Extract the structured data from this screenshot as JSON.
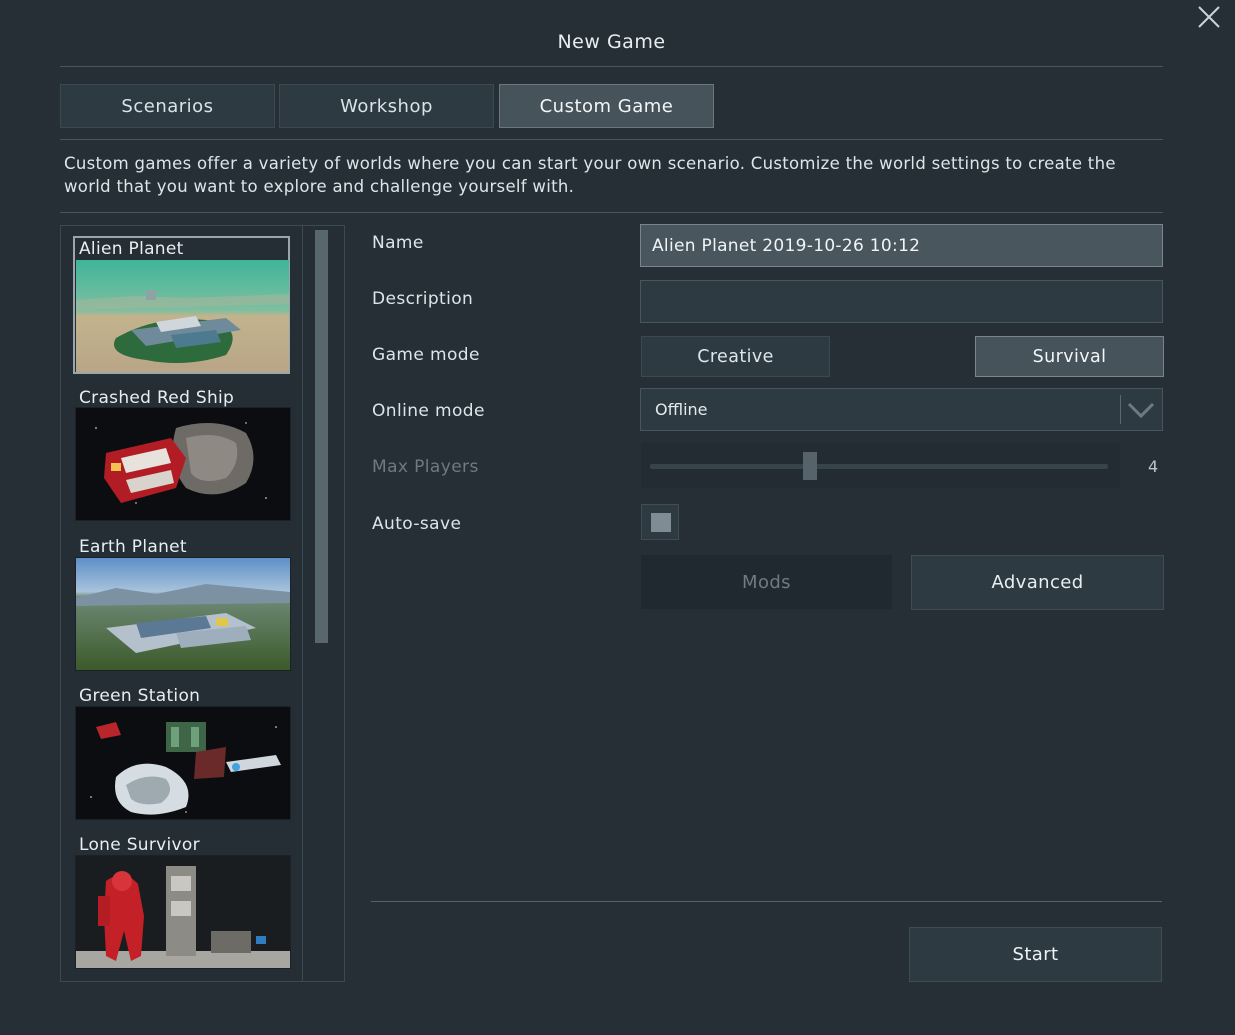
{
  "window": {
    "title": "New Game"
  },
  "tabs": [
    {
      "label": "Scenarios",
      "active": false
    },
    {
      "label": "Workshop",
      "active": false
    },
    {
      "label": "Custom Game",
      "active": true
    }
  ],
  "description": "Custom games offer a variety of worlds where you can start your own scenario. Customize the world settings to create the world that you want to explore and challenge yourself with.",
  "worlds": [
    {
      "label": "Alien Planet",
      "selected": true
    },
    {
      "label": "Crashed Red Ship",
      "selected": false
    },
    {
      "label": "Earth Planet",
      "selected": false
    },
    {
      "label": "Green Station",
      "selected": false
    },
    {
      "label": "Lone Survivor",
      "selected": false
    }
  ],
  "settings": {
    "name_label": "Name",
    "name_value": "Alien Planet 2019-10-26 10:12",
    "description_label": "Description",
    "description_value": "",
    "game_mode_label": "Game mode",
    "game_mode_options": [
      "Creative",
      "Survival"
    ],
    "game_mode_selected": "Survival",
    "online_mode_label": "Online mode",
    "online_mode_value": "Offline",
    "max_players_label": "Max Players",
    "max_players_value": "4",
    "max_players_level": 0.35,
    "auto_save_label": "Auto-save"
  },
  "buttons": {
    "mods": "Mods",
    "advanced": "Advanced",
    "start": "Start"
  },
  "icons": {
    "close": "close-icon",
    "dropdown": "chevron-down-icon"
  },
  "colors": {
    "background": "#262f36",
    "panel": "#2d3a42",
    "active": "#47535b"
  }
}
